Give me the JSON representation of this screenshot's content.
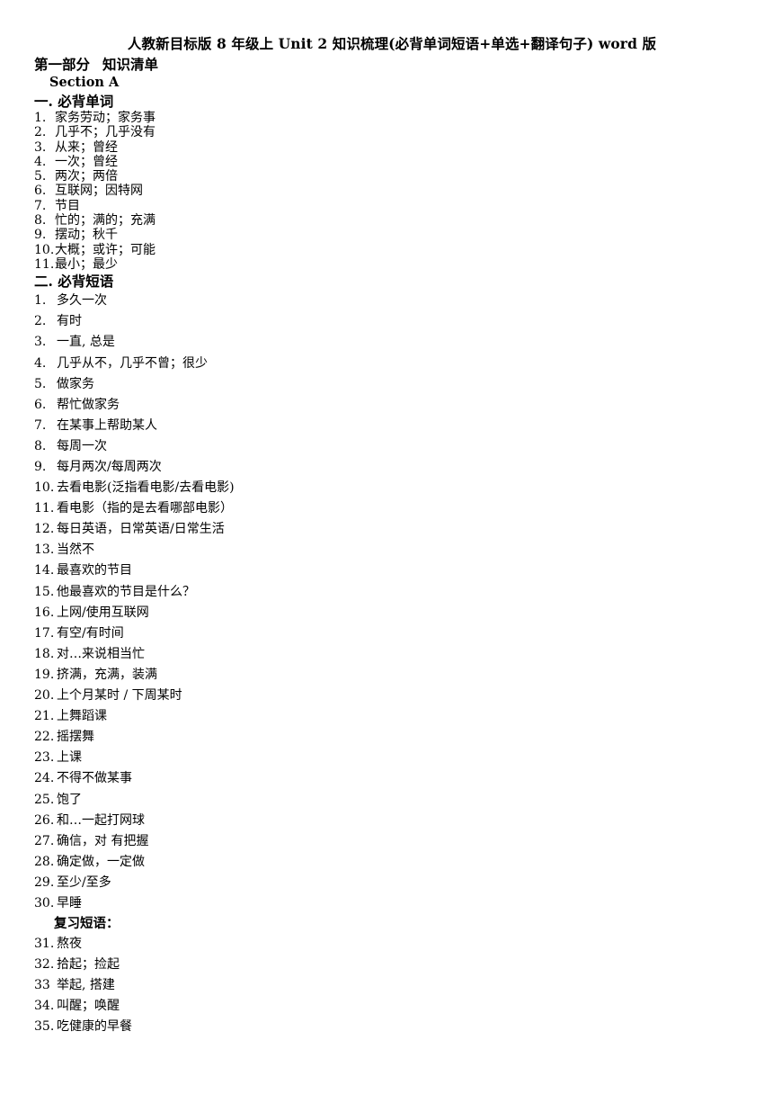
{
  "document": {
    "title": "人教新目标版 8 年级上  Unit 2  知识梳理(必背单词短语+单选+翻译句子) word 版",
    "part_label": "第一部分",
    "part_name": "知识清单",
    "section_label": "Section A"
  },
  "words_section": {
    "heading": "一. 必背单词",
    "items": [
      {
        "num": "1.",
        "text": "家务劳动；家务事"
      },
      {
        "num": "2.",
        "text": "几乎不；几乎没有"
      },
      {
        "num": "3.",
        "text": "从来；曾经"
      },
      {
        "num": "4.",
        "text": "一次；曾经"
      },
      {
        "num": "5.",
        "text": "两次；两倍"
      },
      {
        "num": "6.",
        "text": "互联网；因特网"
      },
      {
        "num": "7.",
        "text": "节目"
      },
      {
        "num": "8.",
        "text": "忙的；满的；充满"
      },
      {
        "num": "9.",
        "text": "摆动；秋千"
      },
      {
        "num": "10.",
        "text": "大概；或许；可能"
      },
      {
        "num": "11.",
        "text": "最小；最少"
      }
    ]
  },
  "phrases_section": {
    "heading": "二. 必背短语",
    "items": [
      {
        "num": "1.",
        "text": "多久一次"
      },
      {
        "num": "2.",
        "text": "有时"
      },
      {
        "num": "3.",
        "text": "一直, 总是"
      },
      {
        "num": "4.",
        "text": "几乎从不，几乎不曾；很少"
      },
      {
        "num": "5.",
        "text": "做家务"
      },
      {
        "num": "6.",
        "text": "帮忙做家务"
      },
      {
        "num": "7.",
        "text": "在某事上帮助某人"
      },
      {
        "num": "8.",
        "text": "每周一次"
      },
      {
        "num": "9.",
        "text": "每月两次/每周两次"
      },
      {
        "num": "10.",
        "text": "去看电影(泛指看电影/去看电影)"
      },
      {
        "num": "11.",
        "text": "看电影（指的是去看哪部电影）"
      },
      {
        "num": "12.",
        "text": "每日英语，日常英语/日常生活"
      },
      {
        "num": "13.",
        "text": "当然不"
      },
      {
        "num": "14.",
        "text": "最喜欢的节目"
      },
      {
        "num": "15.",
        "text": "他最喜欢的节目是什么？"
      },
      {
        "num": "16.",
        "text": "上网/使用互联网"
      },
      {
        "num": "17.",
        "text": "有空/有时间"
      },
      {
        "num": "18.",
        "text": "对…来说相当忙"
      },
      {
        "num": "19.",
        "text": "挤满，充满，装满"
      },
      {
        "num": "20.",
        "text": "上个月某时 / 下周某时"
      },
      {
        "num": "21.",
        "text": "上舞蹈课"
      },
      {
        "num": "22.",
        "text": "摇摆舞"
      },
      {
        "num": "23.",
        "text": "上课"
      },
      {
        "num": "24.",
        "text": "不得不做某事"
      },
      {
        "num": "25.",
        "text": "饱了"
      },
      {
        "num": "26.",
        "text": "和…一起打网球"
      },
      {
        "num": "27.",
        "text": "确信，对    有把握"
      },
      {
        "num": "28.",
        "text": "确定做，一定做"
      },
      {
        "num": "29.",
        "text": "至少/至多"
      },
      {
        "num": "30.",
        "text": "早睡"
      }
    ]
  },
  "review_section": {
    "heading": "复习短语：",
    "items": [
      {
        "num": "31.",
        "text": "熬夜"
      },
      {
        "num": "32.",
        "text": "拾起；捡起"
      },
      {
        "num": "33",
        "text": "举起, 搭建"
      },
      {
        "num": "34.",
        "text": "叫醒；唤醒"
      },
      {
        "num": "35.",
        "text": "吃健康的早餐"
      }
    ]
  }
}
